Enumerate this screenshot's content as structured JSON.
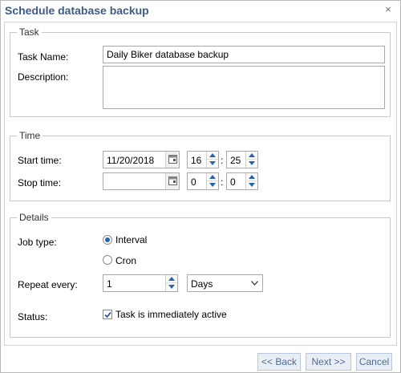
{
  "dialog": {
    "title": "Schedule database backup",
    "close_icon": "close-icon"
  },
  "task": {
    "legend": "Task",
    "name_label": "Task Name:",
    "name_value": "Daily Biker database backup",
    "description_label": "Description:",
    "description_value": ""
  },
  "time": {
    "legend": "Time",
    "start_label": "Start time:",
    "start_date": "11/20/2018",
    "start_hour": "16",
    "start_minute": "25",
    "stop_label": "Stop time:",
    "stop_date": "",
    "stop_hour": "0",
    "stop_minute": "0",
    "separator": ":",
    "calendar_icon": "calendar-icon"
  },
  "details": {
    "legend": "Details",
    "job_type_label": "Job type:",
    "job_type_options": [
      "Interval",
      "Cron"
    ],
    "job_type_selected": "Interval",
    "repeat_label": "Repeat every:",
    "repeat_value": "1",
    "repeat_unit": "Days",
    "status_label": "Status:",
    "status_checkbox_label": "Task is immediately active",
    "status_checked": true
  },
  "footer": {
    "back_label": "<< Back",
    "next_label": "Next >>",
    "cancel_label": "Cancel"
  },
  "colors": {
    "title": "#3d5b86",
    "button_bg": "#e9eef5",
    "button_border": "#b8c8dc",
    "button_text": "#4c6b93",
    "accent": "#2b62b0"
  }
}
